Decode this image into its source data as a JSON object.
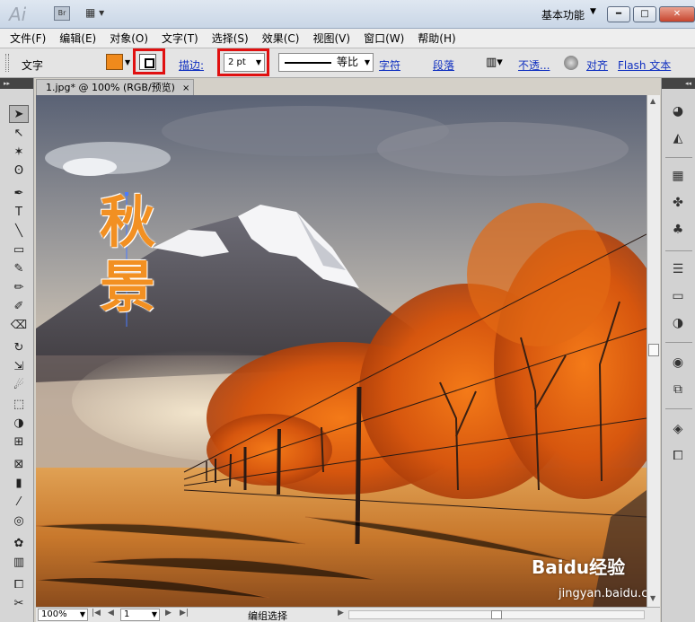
{
  "titlebar": {
    "app_logo": "Ai",
    "bridge_label": "Br",
    "workspace": "基本功能",
    "minimize": "━",
    "maximize": "□",
    "close": "✕"
  },
  "menu": [
    "文件(F)",
    "编辑(E)",
    "对象(O)",
    "文字(T)",
    "选择(S)",
    "效果(C)",
    "视图(V)",
    "窗口(W)",
    "帮助(H)"
  ],
  "control": {
    "selection_label": "文字",
    "stroke_label": "描边:",
    "stroke_weight": "2 pt",
    "profile_label": "等比",
    "character_link": "字符",
    "paragraph_link": "段落",
    "opacity_link": "不透...",
    "align_link": "对齐",
    "flash_text_link": "Flash 文本"
  },
  "document": {
    "tab_title": "1.jpg* @ 100% (RGB/预览)",
    "artwork_text": [
      "秋",
      "景"
    ]
  },
  "status": {
    "zoom": "100%",
    "page": "1",
    "mode": "编组选择"
  },
  "watermark": {
    "brand": "Baidu经验",
    "url": "jingyan.baidu.com"
  },
  "colors": {
    "fill": "#f08a1c",
    "highlight": "#e01010",
    "text_orange": "#f29022"
  },
  "tools": [
    "selection-tool",
    "direct-selection-tool",
    "magic-wand-tool",
    "lasso-tool",
    "pen-tool",
    "type-tool",
    "line-tool",
    "rectangle-tool",
    "paintbrush-tool",
    "pencil-tool",
    "blob-brush-tool",
    "eraser-tool",
    "rotate-tool",
    "scale-tool",
    "warp-tool",
    "free-transform-tool",
    "shape-builder-tool",
    "perspective-grid-tool",
    "mesh-tool",
    "gradient-tool",
    "eyedropper-tool",
    "blend-tool",
    "symbol-sprayer-tool",
    "column-graph-tool",
    "artboard-tool",
    "slice-tool"
  ],
  "dock_panels": [
    "color-panel",
    "color-guide-panel",
    "swatches-panel",
    "brushes-panel",
    "symbols-panel",
    "stroke-panel",
    "gradient-panel",
    "transparency-panel",
    "appearance-panel",
    "graphic-styles-panel",
    "layers-panel",
    "artboards-panel"
  ]
}
